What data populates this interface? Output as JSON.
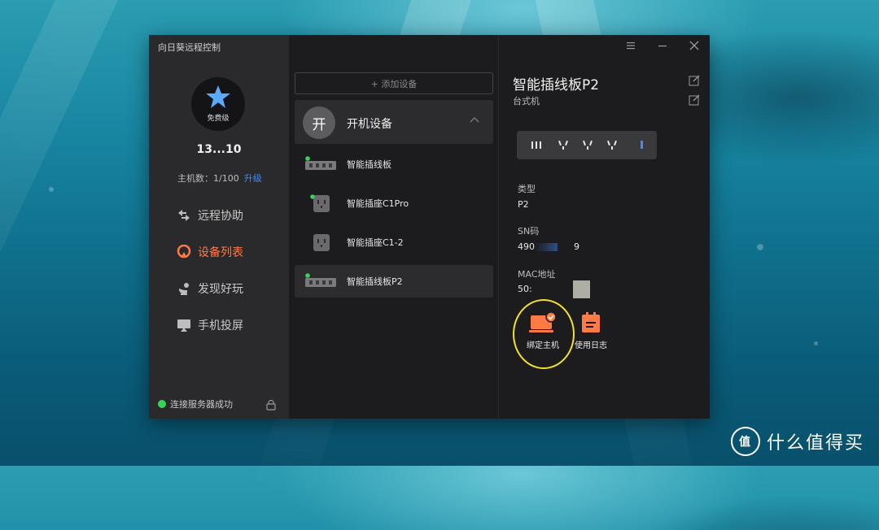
{
  "app": {
    "title": "向日葵远程控制"
  },
  "profile": {
    "tier": "免费级",
    "user_id": "13...10",
    "hosts_label": "主机数：1/100",
    "upgrade_label": "升级"
  },
  "nav": [
    {
      "label": "远程协助",
      "icon": "remote-assist-icon"
    },
    {
      "label": "设备列表",
      "icon": "device-list-icon"
    },
    {
      "label": "发现好玩",
      "icon": "discover-icon"
    },
    {
      "label": "手机投屏",
      "icon": "screen-mirror-icon"
    }
  ],
  "nav_active_index": 1,
  "status": {
    "text": "连接服务器成功"
  },
  "device_list": {
    "add_label": "+ 添加设备",
    "group": {
      "badge": "开",
      "name": "开机设备"
    },
    "devices": [
      {
        "name": "智能插线板",
        "online": true
      },
      {
        "name": "智能插座C1Pro",
        "online": true
      },
      {
        "name": "智能插座C1-2",
        "online": false
      },
      {
        "name": "智能插线板P2",
        "online": true
      }
    ],
    "selected_index": 3
  },
  "detail": {
    "title": "智能插线板P2",
    "subtitle": "台式机",
    "type_label": "类型",
    "type_value": "P2",
    "sn_label": "SN码",
    "sn_value": "490",
    "sn_suffix": "9",
    "mac_label": "MAC地址",
    "mac_value": "50:",
    "actions": [
      {
        "label": "绑定主机",
        "icon": "bind-host-icon"
      },
      {
        "label": "使用日志",
        "icon": "usage-log-icon"
      }
    ]
  },
  "colors": {
    "accent": "#ff7a45",
    "link": "#3d8bff",
    "online": "#3bd45b",
    "highlight": "#f4e12a"
  },
  "watermark": {
    "logo_text": "值",
    "text": "什么值得买"
  }
}
